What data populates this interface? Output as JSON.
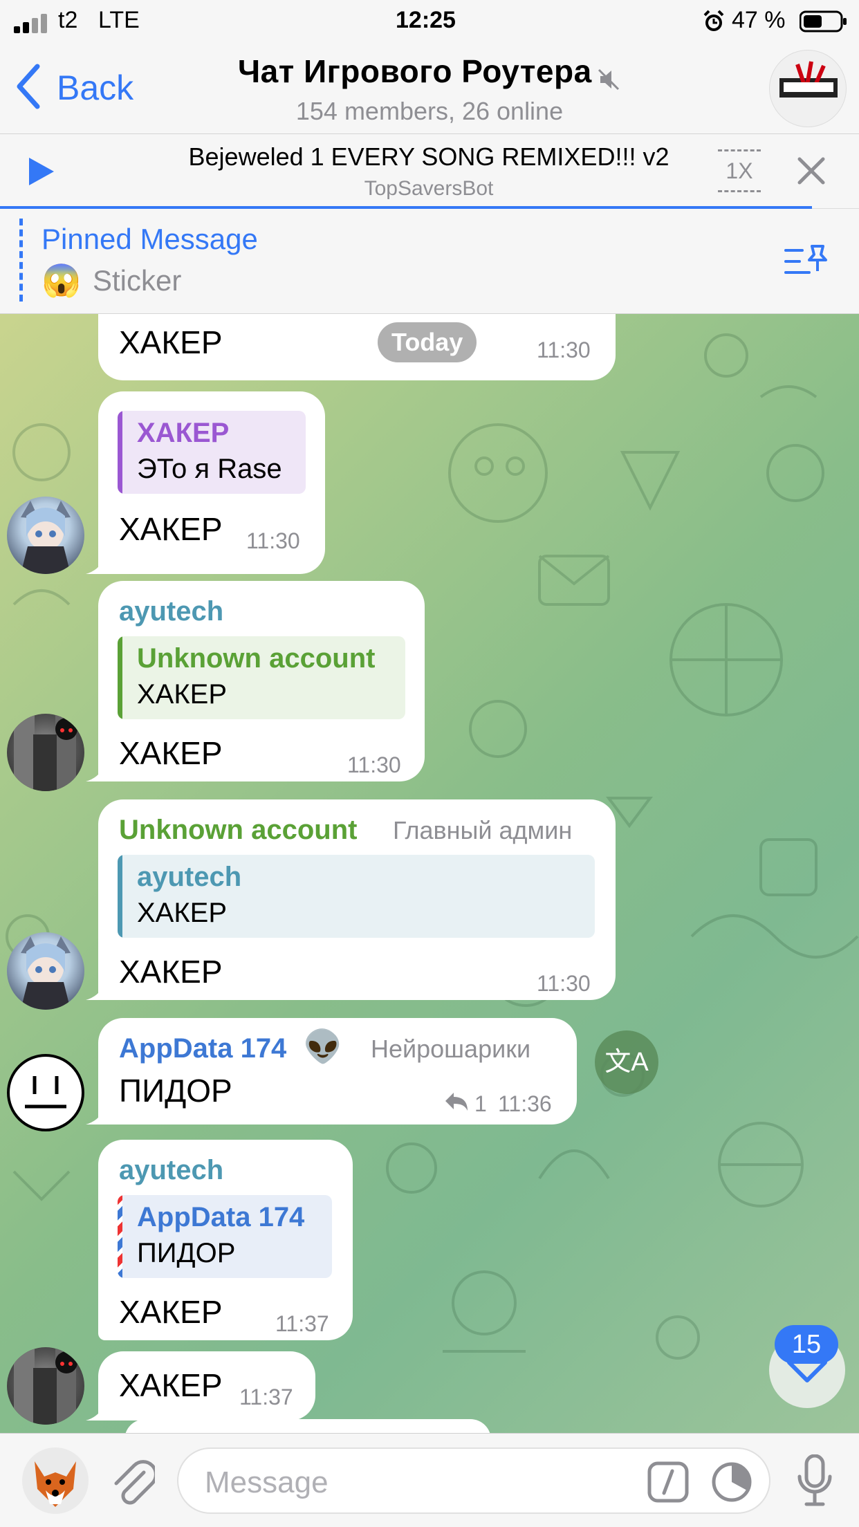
{
  "status": {
    "carrier": "t2",
    "network": "LTE",
    "time": "12:25",
    "battery": "47 %"
  },
  "nav": {
    "back": "Back",
    "title": "Чат Игрового Роутера",
    "subtitle": "154 members, 26 online"
  },
  "player": {
    "title": "Bejeweled 1 EVERY SONG REMIXED!!! v2",
    "subtitle": "TopSaversBot",
    "speed": "1X"
  },
  "pinned": {
    "label": "Pinned Message",
    "emoji": "😱",
    "text": "Sticker"
  },
  "date_badge": "Today",
  "messages": [
    {
      "text": "ХАКЕР",
      "time": "11:30"
    },
    {
      "reply_name": "ХАКЕР",
      "reply_text": "ЭТо я Rase",
      "text": "ХАКЕР",
      "time": "11:30"
    },
    {
      "sender": "ayutech",
      "reply_name": "Unknown account",
      "reply_text": "ХАКЕР",
      "text": "ХАКЕР",
      "time": "11:30"
    },
    {
      "sender": "Unknown account",
      "role": "Главный админ",
      "reply_name": "ayutech",
      "reply_text": "ХАКЕР",
      "text": "ХАКЕР",
      "time": "11:30"
    },
    {
      "sender": "AppData 174",
      "sender_emoji": "👽",
      "role": "Нейрошарики",
      "text": "ПИДОР",
      "replies": "1",
      "time": "11:36"
    },
    {
      "sender": "ayutech",
      "reply_name": "AppData 174",
      "reply_text": "ПИДОР",
      "text": "ХАКЕР",
      "time": "11:37"
    },
    {
      "text": "ХАКЕР",
      "time": "11:37"
    }
  ],
  "translate_icon": "文A",
  "unread_count": "15",
  "input": {
    "placeholder": "Message"
  },
  "colors": {
    "accent": "#3478f6",
    "purple": "#9a57d2",
    "green": "#5aa136",
    "teal": "#4d98b2",
    "blue_name": "#3d78d4"
  }
}
